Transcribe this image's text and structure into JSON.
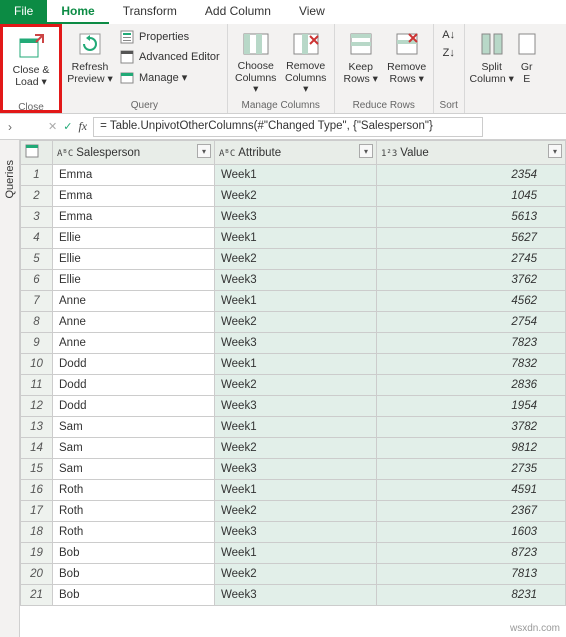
{
  "tabs": {
    "file": "File",
    "home": "Home",
    "transform": "Transform",
    "addColumn": "Add Column",
    "view": "View"
  },
  "ribbon": {
    "close": {
      "label": "Close &\nLoad ▾",
      "group": "Close"
    },
    "refresh": {
      "label": "Refresh\nPreview ▾"
    },
    "properties": "Properties",
    "advancedEditor": "Advanced Editor",
    "manage": "Manage ▾",
    "queryGroup": "Query",
    "chooseCols": "Choose\nColumns ▾",
    "removeCols": "Remove\nColumns ▾",
    "manageColsGroup": "Manage Columns",
    "keepRows": "Keep\nRows ▾",
    "removeRows": "Remove\nRows ▾",
    "reduceRowsGroup": "Reduce Rows",
    "sortGroup": "Sort",
    "splitCol": "Split\nColumn ▾",
    "groupBy": "Gr\nE"
  },
  "formula": {
    "fx": "fx",
    "value": "= Table.UnpivotOtherColumns(#\"Changed Type\", {\"Salesperson\"}"
  },
  "sidebar": {
    "queries": "Queries"
  },
  "columns": {
    "salesperson": {
      "type": "AᴮC",
      "label": "Salesperson"
    },
    "attribute": {
      "type": "AᴮC",
      "label": "Attribute"
    },
    "value": {
      "type": "1²3",
      "label": "Value"
    }
  },
  "rows": [
    {
      "n": 1,
      "sp": "Emma",
      "attr": "Week1",
      "val": 2354
    },
    {
      "n": 2,
      "sp": "Emma",
      "attr": "Week2",
      "val": 1045
    },
    {
      "n": 3,
      "sp": "Emma",
      "attr": "Week3",
      "val": 5613
    },
    {
      "n": 4,
      "sp": "Ellie",
      "attr": "Week1",
      "val": 5627
    },
    {
      "n": 5,
      "sp": "Ellie",
      "attr": "Week2",
      "val": 2745
    },
    {
      "n": 6,
      "sp": "Ellie",
      "attr": "Week3",
      "val": 3762
    },
    {
      "n": 7,
      "sp": "Anne",
      "attr": "Week1",
      "val": 4562
    },
    {
      "n": 8,
      "sp": "Anne",
      "attr": "Week2",
      "val": 2754
    },
    {
      "n": 9,
      "sp": "Anne",
      "attr": "Week3",
      "val": 7823
    },
    {
      "n": 10,
      "sp": "Dodd",
      "attr": "Week1",
      "val": 7832
    },
    {
      "n": 11,
      "sp": "Dodd",
      "attr": "Week2",
      "val": 2836
    },
    {
      "n": 12,
      "sp": "Dodd",
      "attr": "Week3",
      "val": 1954
    },
    {
      "n": 13,
      "sp": "Sam",
      "attr": "Week1",
      "val": 3782
    },
    {
      "n": 14,
      "sp": "Sam",
      "attr": "Week2",
      "val": 9812
    },
    {
      "n": 15,
      "sp": "Sam",
      "attr": "Week3",
      "val": 2735
    },
    {
      "n": 16,
      "sp": "Roth",
      "attr": "Week1",
      "val": 4591
    },
    {
      "n": 17,
      "sp": "Roth",
      "attr": "Week2",
      "val": 2367
    },
    {
      "n": 18,
      "sp": "Roth",
      "attr": "Week3",
      "val": 1603
    },
    {
      "n": 19,
      "sp": "Bob",
      "attr": "Week1",
      "val": 8723
    },
    {
      "n": 20,
      "sp": "Bob",
      "attr": "Week2",
      "val": 7813
    },
    {
      "n": 21,
      "sp": "Bob",
      "attr": "Week3",
      "val": 8231
    }
  ],
  "watermark": "wsxdn.com"
}
